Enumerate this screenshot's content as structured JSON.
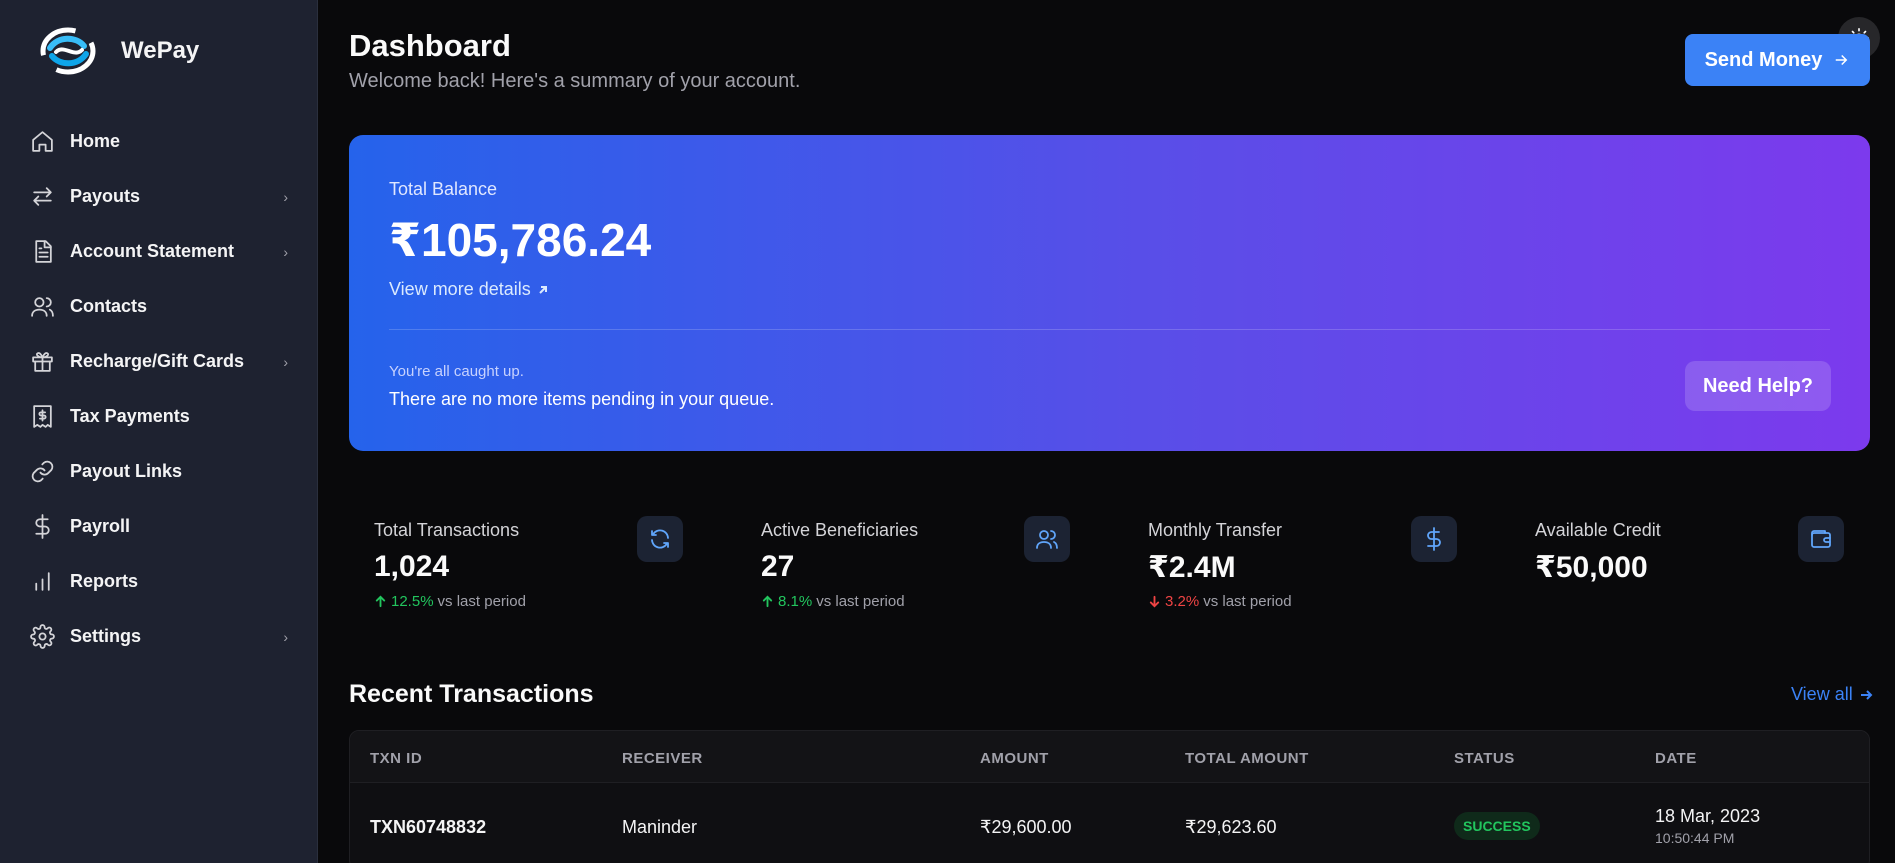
{
  "brand": {
    "name": "WePay"
  },
  "sidebar": {
    "items": [
      {
        "label": "Home",
        "icon": "home-icon",
        "chevron": false
      },
      {
        "label": "Payouts",
        "icon": "arrows-icon",
        "chevron": true
      },
      {
        "label": "Account Statement",
        "icon": "document-icon",
        "chevron": true
      },
      {
        "label": "Contacts",
        "icon": "users-icon",
        "chevron": false
      },
      {
        "label": "Recharge/Gift Cards",
        "icon": "gift-icon",
        "chevron": true
      },
      {
        "label": "Tax Payments",
        "icon": "receipt-icon",
        "chevron": false
      },
      {
        "label": "Payout Links",
        "icon": "link-icon",
        "chevron": false
      },
      {
        "label": "Payroll",
        "icon": "dollar-icon",
        "chevron": false
      },
      {
        "label": "Reports",
        "icon": "bar-chart-icon",
        "chevron": false
      },
      {
        "label": "Settings",
        "icon": "gear-icon",
        "chevron": true
      }
    ],
    "chevron_glyph": "›"
  },
  "header": {
    "title": "Dashboard",
    "subtitle": "Welcome back! Here's a summary of your account.",
    "send_label": "Send Money"
  },
  "balance": {
    "label": "Total Balance",
    "amount": "₹105,786.24",
    "link": "View more details",
    "caught_up": "You're all caught up.",
    "queue": "There are no more items pending in your queue.",
    "help_label": "Need Help?"
  },
  "stats": [
    {
      "label": "Total Transactions",
      "value": "1,024",
      "change": "12.5%",
      "direction": "up",
      "suffix": "vs last period",
      "icon": "refresh-icon"
    },
    {
      "label": "Active Beneficiaries",
      "value": "27",
      "change": "8.1%",
      "direction": "up",
      "suffix": "vs last period",
      "icon": "users-icon"
    },
    {
      "label": "Monthly Transfer",
      "value": "₹2.4M",
      "change": "3.2%",
      "direction": "down",
      "suffix": "vs last period",
      "icon": "dollar-icon"
    },
    {
      "label": "Available Credit",
      "value": "₹50,000",
      "icon": "wallet-icon"
    }
  ],
  "recent": {
    "title": "Recent Transactions",
    "view_all": "View all",
    "columns": [
      "TXN ID",
      "RECEIVER",
      "AMOUNT",
      "TOTAL AMOUNT",
      "STATUS",
      "DATE"
    ],
    "rows": [
      {
        "txn_id": "TXN60748832",
        "receiver": "Maninder",
        "amount": "₹29,600.00",
        "total": "₹29,623.60",
        "status": "SUCCESS",
        "date": "18 Mar, 2023",
        "time": "10:50:44 PM"
      }
    ]
  },
  "colors": {
    "accent": "#3b82f6",
    "success": "#22c55e",
    "danger": "#ef4444",
    "sidebar_bg": "#1e2230",
    "page_bg": "#09090b"
  }
}
